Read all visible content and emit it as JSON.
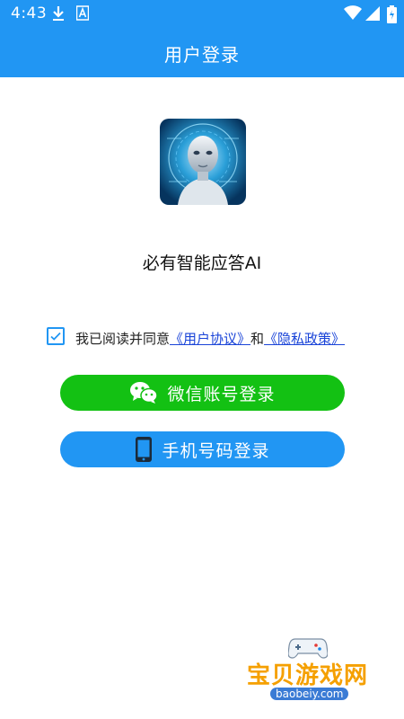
{
  "status_bar": {
    "time": "4:43",
    "icons": [
      "download-icon",
      "a-badge-icon",
      "wifi-icon",
      "signal-icon",
      "battery-icon"
    ]
  },
  "app_bar": {
    "title": "用户登录"
  },
  "app": {
    "name": "必有智能应答AI",
    "logo_icon": "robot-face-logo"
  },
  "agreement": {
    "checked": true,
    "prefix": "我已阅读并同意",
    "user_agreement": "《用户协议》",
    "conjunction": "和",
    "privacy_policy": "《隐私政策》"
  },
  "buttons": {
    "wechat": {
      "label": "微信账号登录",
      "icon": "wechat-icon"
    },
    "phone": {
      "label": "手机号码登录",
      "icon": "phone-icon"
    }
  },
  "watermark": {
    "text": "宝贝游戏网",
    "url": "baobeiy.com"
  },
  "colors": {
    "primary": "#2196f3",
    "wechat_green": "#13c113",
    "link": "#1a44d8"
  }
}
